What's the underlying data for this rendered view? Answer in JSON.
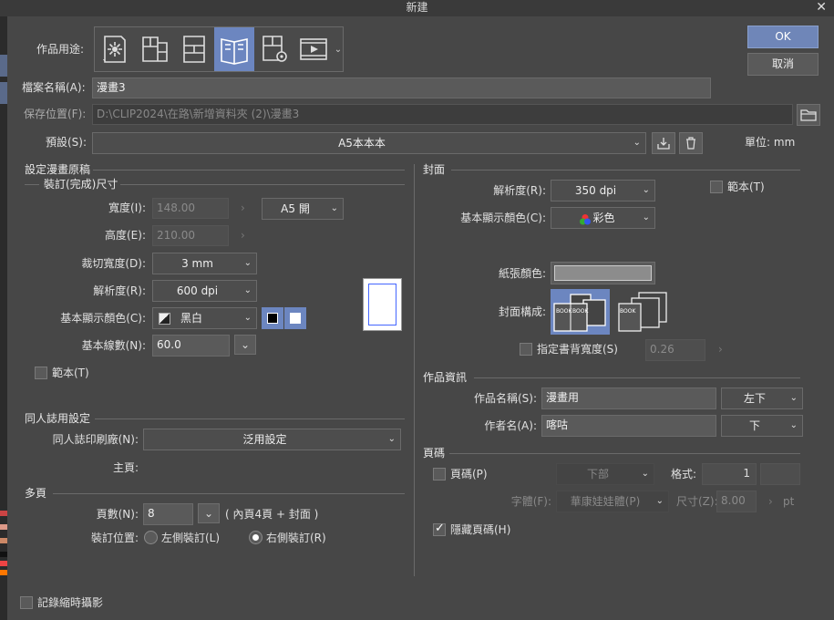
{
  "window": {
    "title": "新建"
  },
  "buttons": {
    "ok": "OK",
    "cancel": "取消"
  },
  "work_use": {
    "label": "作品用途:"
  },
  "file_name": {
    "label": "檔案名稱(A):",
    "value": "漫畫3"
  },
  "save_location": {
    "label": "保存位置(F):",
    "value": "D:\\CLIP2024\\在路\\新增資料夾 (2)\\漫畫3"
  },
  "preset": {
    "label": "預設(S):",
    "value": "A5本本本",
    "unit_label": "單位:",
    "unit_value": "mm"
  },
  "manga": {
    "section_title": "設定漫畫原稿",
    "bind_title": "裝訂(完成)尺寸",
    "width": {
      "label": "寬度(I):",
      "value": "148.00"
    },
    "height": {
      "label": "高度(E):",
      "value": "210.00"
    },
    "size_preset": "A5 開",
    "bleed": {
      "label": "裁切寬度(D):",
      "value": "3 mm"
    },
    "resolution": {
      "label": "解析度(R):",
      "value": "600 dpi"
    },
    "color": {
      "label": "基本顯示顏色(C):",
      "value": "黑白"
    },
    "lines": {
      "label": "基本線數(N):",
      "value": "60.0"
    },
    "template": {
      "label": "範本(T)"
    }
  },
  "doujin": {
    "section_title": "同人誌用設定",
    "printer": {
      "label": "同人誌印刷廠(N):",
      "value": "泛用設定"
    },
    "main_page": {
      "label": "主頁:"
    }
  },
  "multipage": {
    "section_title": "多頁",
    "pages": {
      "label": "頁數(N):",
      "value": "8",
      "note": "( 內頁4頁 + 封面 )"
    },
    "binding": {
      "label": "裝訂位置:",
      "left": "左側裝訂(L)",
      "right": "右側裝訂(R)"
    }
  },
  "cover": {
    "section_title": "封面",
    "resolution": {
      "label": "解析度(R):",
      "value": "350 dpi"
    },
    "template": {
      "label": "範本(T)"
    },
    "color": {
      "label": "基本顯示顏色(C):",
      "value": "彩色"
    },
    "paper_color": {
      "label": "紙張顏色:"
    },
    "structure": {
      "label": "封面構成:"
    },
    "spine": {
      "label": "指定書背寬度(S)",
      "value": "0.26"
    }
  },
  "work_info": {
    "section_title": "作品資訊",
    "work_name": {
      "label": "作品名稱(S):",
      "value": "漫畫用",
      "position": "左下"
    },
    "author": {
      "label": "作者名(A):",
      "value": "喀咕",
      "position": "下"
    }
  },
  "page_number": {
    "section_title": "頁碼",
    "enable": {
      "label": "頁碼(P)"
    },
    "position": "下部",
    "format": {
      "label": "格式:",
      "value": "1"
    },
    "font": {
      "label": "字體(F):",
      "value": "華康娃娃體(P)"
    },
    "size": {
      "label": "尺寸(Z):",
      "value": "8.00",
      "unit": "pt"
    },
    "hide": {
      "label": "隱藏頁碼(H)"
    }
  },
  "timelapse": {
    "label": "記錄縮時攝影"
  },
  "colors": {
    "accent": "#6f86b8",
    "bg": "#474747"
  }
}
